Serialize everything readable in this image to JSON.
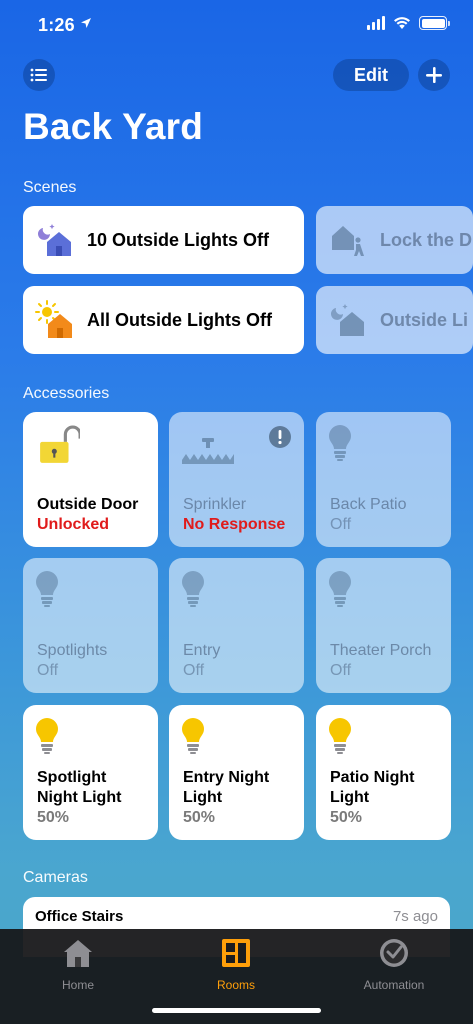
{
  "status_bar": {
    "time": "1:26"
  },
  "header": {
    "edit_label": "Edit",
    "title": "Back Yard"
  },
  "sections": {
    "scenes": "Scenes",
    "accessories": "Accessories",
    "cameras": "Cameras"
  },
  "scenes": [
    {
      "label": "10 Outside Lights Off",
      "state": "on",
      "icon": "night-home-icon"
    },
    {
      "label": "Lock the D",
      "state": "off",
      "icon": "leave-home-icon"
    },
    {
      "label": "All Outside Lights Off",
      "state": "on",
      "icon": "sun-home-icon"
    },
    {
      "label": "Outside Li",
      "state": "off",
      "icon": "night-home-icon"
    }
  ],
  "accessories": [
    {
      "name": "Outside Door",
      "status": "Unlocked",
      "state": "on",
      "status_alert": true,
      "icon": "unlocked-padlock-icon"
    },
    {
      "name": "Sprinkler",
      "status": "No Response",
      "state": "off",
      "status_alert": true,
      "icon": "sprinkler-icon"
    },
    {
      "name": "Back Patio",
      "status": "Off",
      "state": "off",
      "icon": "lightbulb-icon"
    },
    {
      "name": "Spotlights",
      "status": "Off",
      "state": "off",
      "icon": "lightbulb-icon"
    },
    {
      "name": "Entry",
      "status": "Off",
      "state": "off",
      "icon": "lightbulb-icon"
    },
    {
      "name": "Theater Porch",
      "status": "Off",
      "state": "off",
      "icon": "lightbulb-icon"
    },
    {
      "name": "Spotlight Night Light",
      "status": "50%",
      "state": "on",
      "icon": "lightbulb-icon"
    },
    {
      "name": "Entry Night Light",
      "status": "50%",
      "state": "on",
      "icon": "lightbulb-icon"
    },
    {
      "name": "Patio Night Light",
      "status": "50%",
      "state": "on",
      "icon": "lightbulb-icon"
    }
  ],
  "camera": {
    "name": "Office Stairs",
    "time": "7s ago"
  },
  "tabs": [
    {
      "label": "Home",
      "icon": "house-icon",
      "active": false
    },
    {
      "label": "Rooms",
      "icon": "rooms-icon",
      "active": true
    },
    {
      "label": "Automation",
      "icon": "clock-icon",
      "active": false
    }
  ],
  "colors": {
    "accent": "#ff9f0a",
    "alert": "#e01b1b",
    "bulb_on": "#f7c600",
    "lock_yellow": "#f2d635"
  }
}
